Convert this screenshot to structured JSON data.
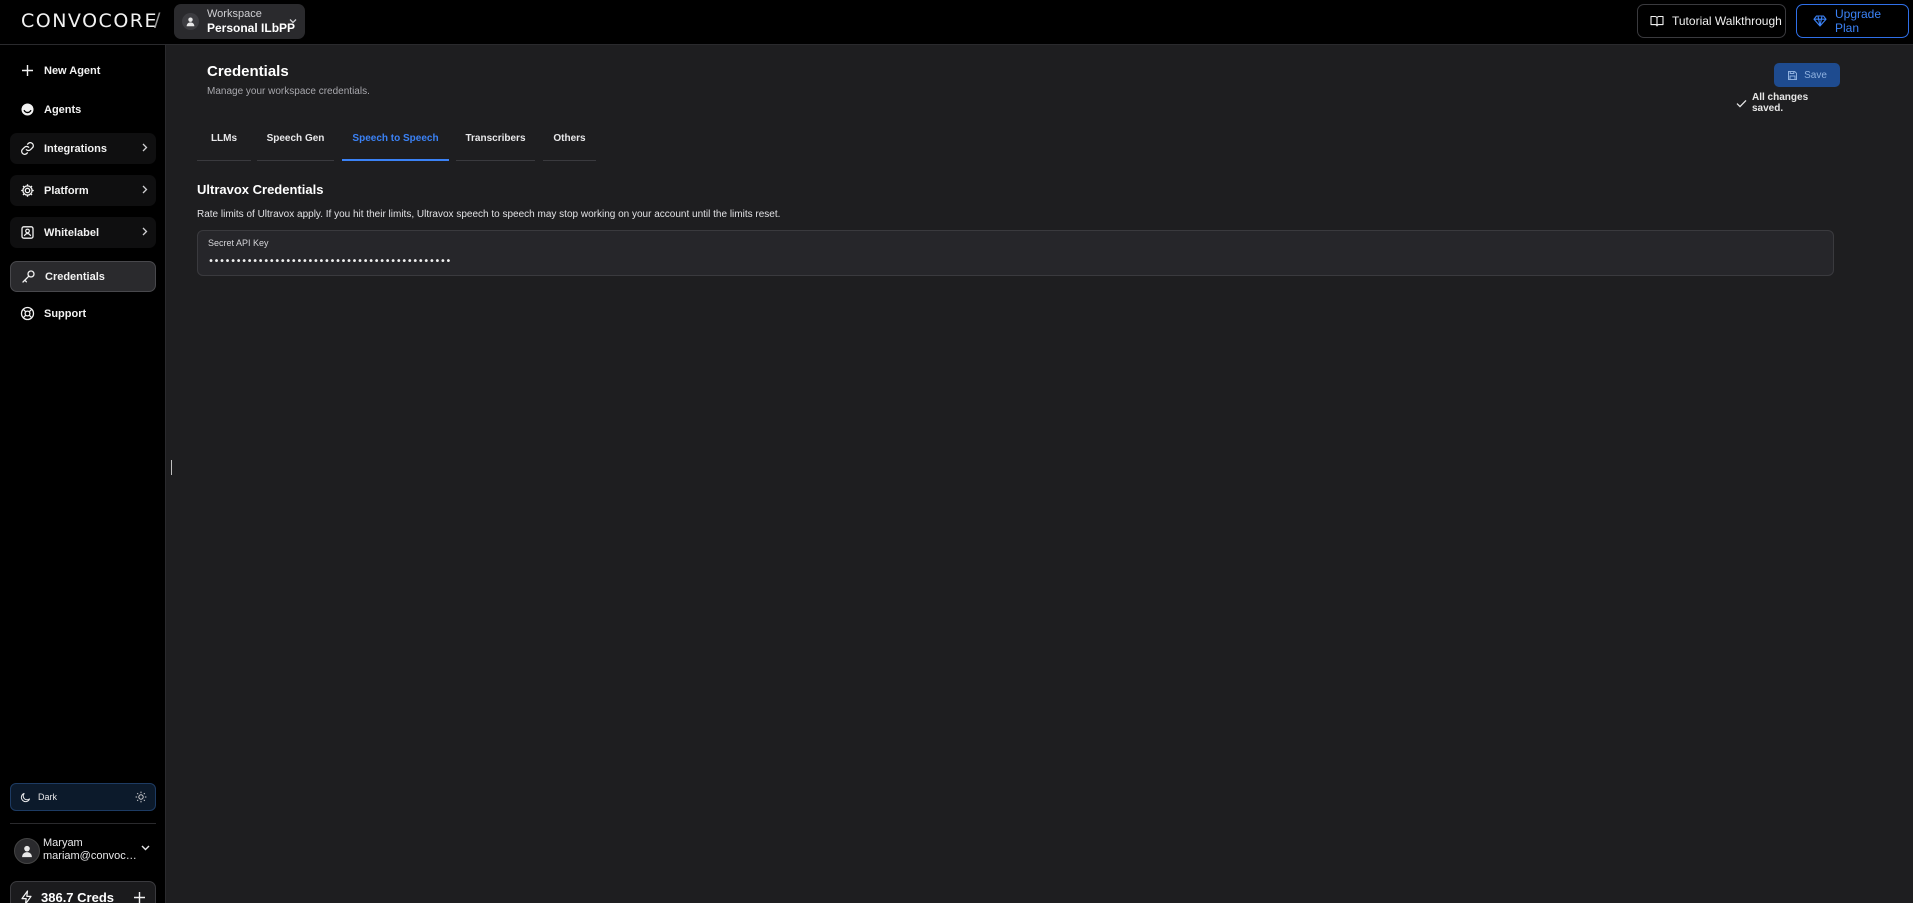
{
  "header": {
    "logo_text": "CONVOCORE",
    "separator": "/",
    "workspace": {
      "label": "Workspace",
      "name": "Personal ILbPP"
    },
    "tutorial_label": "Tutorial Walkthrough",
    "upgrade_label": "Upgrade Plan"
  },
  "sidebar": {
    "items": [
      {
        "label": "New Agent",
        "icon": "plus-icon"
      },
      {
        "label": "Agents",
        "icon": "agent-icon"
      },
      {
        "label": "Integrations",
        "icon": "link-icon",
        "expandable": true
      },
      {
        "label": "Platform",
        "icon": "gear-icon",
        "expandable": true
      },
      {
        "label": "Whitelabel",
        "icon": "badge-icon",
        "expandable": true
      },
      {
        "label": "Credentials",
        "icon": "key-icon",
        "active": true
      },
      {
        "label": "Support",
        "icon": "lifebuoy-icon"
      }
    ],
    "theme_label": "Dark",
    "user": {
      "name": "Maryam",
      "email": "mariam@convocore.ai"
    },
    "credits_label": "386.7 Creds"
  },
  "main": {
    "title": "Credentials",
    "subtitle": "Manage your workspace credentials.",
    "save_label": "Save",
    "saved_status": "All changes saved.",
    "tabs": [
      {
        "label": "LLMs"
      },
      {
        "label": "Speech Gen"
      },
      {
        "label": "Speech to Speech",
        "active": true
      },
      {
        "label": "Transcribers"
      },
      {
        "label": "Others"
      }
    ],
    "section": {
      "title": "Ultravox Credentials",
      "description": "Rate limits of Ultravox apply. If you hit their limits, Ultravox speech to speech may stop working on your account until the limits reset.",
      "field_label": "Secret API Key",
      "field_value": "••••••••••••••••••••••••••••••••••••••••••••"
    }
  },
  "colors": {
    "accent": "#3b82f6",
    "background": "#1e1e20",
    "sidebar": "#000000"
  }
}
